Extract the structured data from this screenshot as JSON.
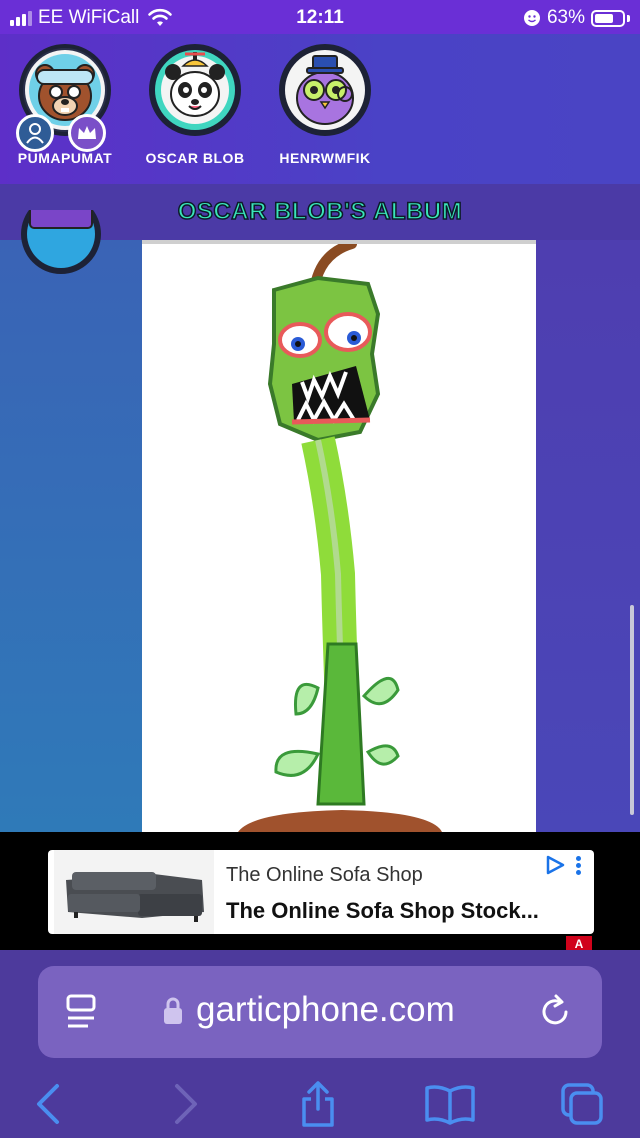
{
  "status_bar": {
    "carrier": "EE WiFiCall",
    "time": "12:11",
    "battery": "63%"
  },
  "players": [
    {
      "name": "PUMAPUMAT",
      "avatar": "bear-avatar-icon"
    },
    {
      "name": "OSCAR BLOB",
      "avatar": "panda-avatar-icon"
    },
    {
      "name": "HENRWMFIK",
      "avatar": "owl-avatar-icon"
    }
  ],
  "album": {
    "title": "OSCAR BLOB'S ALBUM"
  },
  "ad": {
    "title": "The Online Sofa Shop",
    "subtitle": "The Online Sofa Shop Stock...",
    "flag": "A"
  },
  "browser": {
    "url": "garticphone.com"
  },
  "colors": {
    "accent_teal": "#39e6b8",
    "header_purple": "#5d2fc8",
    "link_blue": "#4a8ef0"
  }
}
